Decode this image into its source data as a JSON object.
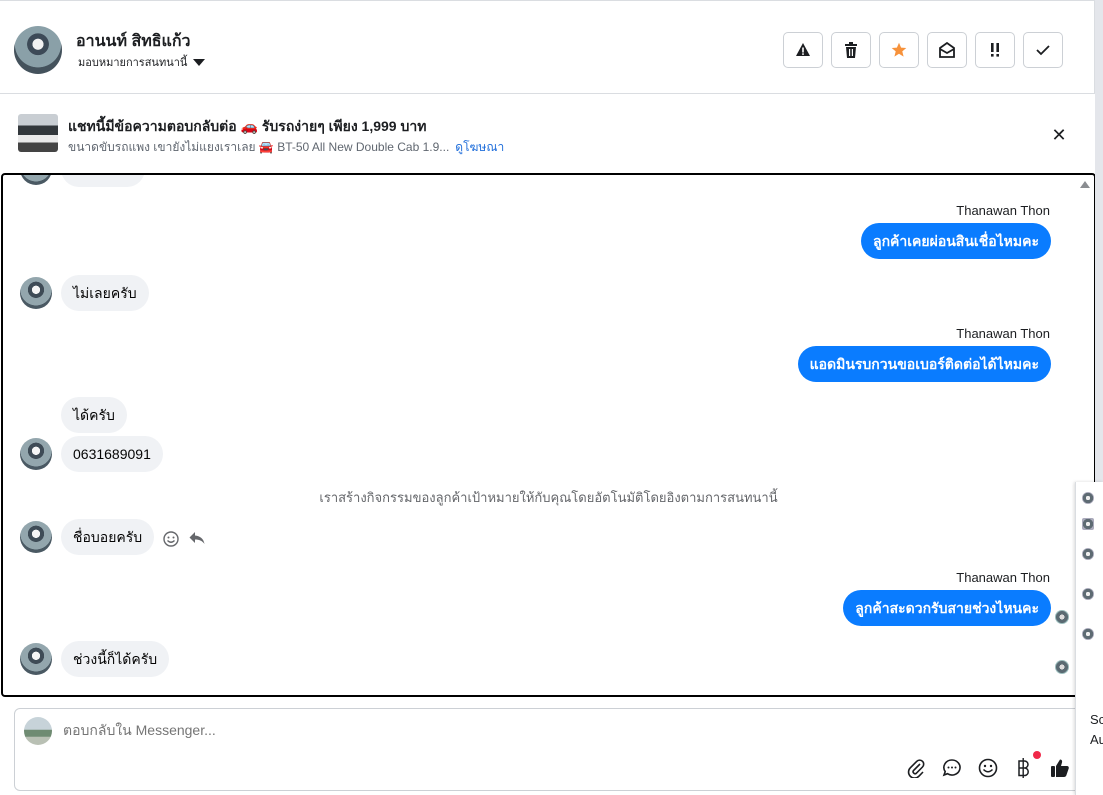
{
  "header": {
    "contact_name": "อานนท์ สิทธิแก้ว",
    "assign_label": "มอบหมายการสนทนานี้",
    "actions": [
      {
        "name": "report-spam-button",
        "icon": "warning-icon"
      },
      {
        "name": "delete-button",
        "icon": "trash-icon"
      },
      {
        "name": "star-button",
        "icon": "star-icon"
      },
      {
        "name": "mark-unread-button",
        "icon": "envelope-open-icon"
      },
      {
        "name": "follow-up-button",
        "icon": "double-exclamation-icon"
      },
      {
        "name": "mark-done-button",
        "icon": "check-icon"
      }
    ],
    "accent_star": "#f7923b"
  },
  "ad": {
    "title": "แชทนี้มีข้อความตอบกลับต่อ 🚗 รับรถง่ายๆ เพียง 1,999 บาท",
    "subtitle": "ขนาดขับรถแพง เขายังไม่แยงเราเลย 🚘 BT-50 All New Double Cab 1.9...",
    "link": "ดูโฆษณา",
    "close": "✕"
  },
  "messages": {
    "sender_1": "Thanawan Thon",
    "out_1": "ลูกค้าเคยผ่อนสินเชื่อไหมคะ",
    "in_1": "ไม่เลยครับ",
    "sender_2": "Thanawan Thon",
    "out_2": "แอดมินรบกวนขอเบอร์ติดต่อได้ไหมคะ",
    "in_2a": "ได้ครับ",
    "in_2b": "0631689091",
    "system_note": "เราสร้างกิจกรรมของลูกค้าเป้าหมายให้กับคุณโดยอัตโนมัติโดยอิงตามการสนทนานี้",
    "in_3": "ชื่อบอยครับ",
    "sender_3": "Thanawan Thon",
    "out_3": "ลูกค้าสะดวกรับสายช่วงไหนคะ",
    "in_4": "ช่วงนี้ก็ได้ครับ",
    "bubble_out_color": "#0a7cff"
  },
  "composer": {
    "placeholder": "ตอบกลับใน Messenger...",
    "tools": [
      "paperclip-icon",
      "chat-bubble-icon",
      "emoji-icon",
      "baht-icon",
      "thumbs-up-icon"
    ]
  },
  "edge_panel": {
    "text_1": "Sc",
    "text_2": "Au"
  }
}
